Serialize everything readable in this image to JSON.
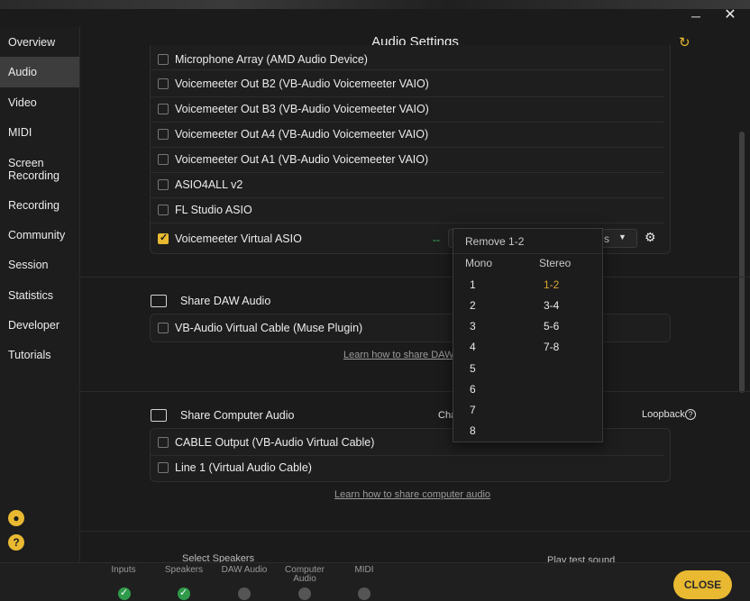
{
  "window": {
    "minimize_glyph": "─",
    "close_glyph": "✕"
  },
  "sidebar": {
    "items": [
      {
        "label": "Overview"
      },
      {
        "label": "Audio"
      },
      {
        "label": "Video"
      },
      {
        "label": "MIDI"
      },
      {
        "label": "Screen Recording"
      },
      {
        "label": "Recording"
      },
      {
        "label": "Community"
      },
      {
        "label": "Session"
      },
      {
        "label": "Statistics"
      },
      {
        "label": "Developer"
      },
      {
        "label": "Tutorials"
      }
    ],
    "account_icon": "account-icon",
    "help_icon": "help-icon"
  },
  "main": {
    "title": "Audio Settings",
    "refresh_glyph": "↻",
    "input_devices": [
      {
        "label": "Microphone Array (AMD Audio Device)",
        "checked": false
      },
      {
        "label": "Voicemeeter Out B2 (VB-Audio Voicemeeter VAIO)",
        "checked": false
      },
      {
        "label": "Voicemeeter Out B3 (VB-Audio Voicemeeter VAIO)",
        "checked": false
      },
      {
        "label": "Voicemeeter Out A4 (VB-Audio Voicemeeter VAIO)",
        "checked": false
      },
      {
        "label": "Voicemeeter Out A1 (VB-Audio Voicemeeter VAIO)",
        "checked": false
      },
      {
        "label": "ASIO4ALL v2",
        "checked": false
      },
      {
        "label": "FL Studio ASIO",
        "checked": false
      },
      {
        "label": "Voicemeeter Virtual ASIO",
        "checked": true
      }
    ],
    "level_dashes": "--",
    "output_select_value": "s",
    "share_daw": {
      "title": "Share DAW Audio",
      "device": "VB-Audio Virtual Cable (Muse Plugin)",
      "link": "Learn how to share DAW"
    },
    "share_computer": {
      "title": "Share Computer Audio",
      "channel_label_partial": "Cha",
      "loopback_label": "Loopback",
      "devices": [
        "CABLE Output (VB-Audio Virtual Cable)",
        "Line 1 (Virtual Audio Cable)"
      ],
      "link": "Learn how to share computer audio"
    },
    "speakers": {
      "title": "Select Speakers",
      "play_test": "Play test sound"
    }
  },
  "dropdown": {
    "remove": "Remove 1-2",
    "mono_header": "Mono",
    "stereo_header": "Stereo",
    "mono": [
      "1",
      "2",
      "3",
      "4",
      "5",
      "6",
      "7",
      "8"
    ],
    "stereo": [
      "1-2",
      "3-4",
      "5-6",
      "7-8"
    ],
    "selected": "1-2"
  },
  "bottombar": {
    "steps": [
      {
        "label": "Inputs",
        "done": true
      },
      {
        "label": "Speakers",
        "done": true
      },
      {
        "label": "DAW Audio",
        "done": false
      },
      {
        "label": "Computer Audio",
        "done": false
      },
      {
        "label": "MIDI",
        "done": false
      }
    ],
    "close_label": "CLOSE"
  },
  "colors": {
    "accent": "#e8b931",
    "ok": "#2f9a4a",
    "selected_stereo": "#d8a531"
  }
}
